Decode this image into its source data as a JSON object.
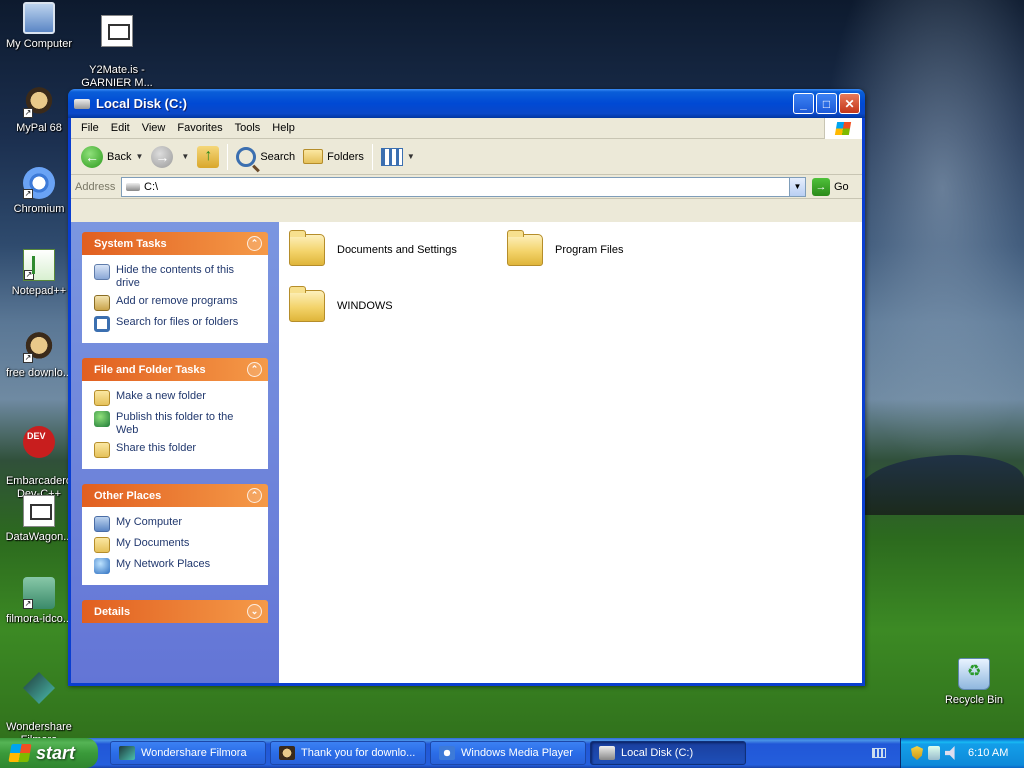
{
  "desktop": {
    "icons": [
      {
        "label": "My Computer"
      },
      {
        "label": "Y2Mate.is -\nGARNIER M..."
      },
      {
        "label": "MyPal 68"
      },
      {
        "label": "Chromium"
      },
      {
        "label": "Notepad++"
      },
      {
        "label": "free downlo..."
      },
      {
        "label": "Embarcadero\nDev-C++"
      },
      {
        "label": "DataWagon..."
      },
      {
        "label": "filmora-idco..."
      },
      {
        "label": "Wondershare\nFilmora"
      },
      {
        "label": "Recycle Bin"
      }
    ]
  },
  "window": {
    "title": "Local Disk (C:)",
    "controls": {
      "minimize": "_",
      "maximize": "□",
      "close": "✕"
    },
    "menu": [
      "File",
      "Edit",
      "View",
      "Favorites",
      "Tools",
      "Help"
    ],
    "toolbar": {
      "back": "Back",
      "search": "Search",
      "folders": "Folders"
    },
    "address": {
      "label": "Address",
      "value": "C:\\",
      "go": "Go"
    },
    "taskpane": {
      "system_tasks": {
        "title": "System Tasks",
        "items": [
          "Hide the contents of this drive",
          "Add or remove programs",
          "Search for files or folders"
        ]
      },
      "file_folder_tasks": {
        "title": "File and Folder Tasks",
        "items": [
          "Make a new folder",
          "Publish this folder to the Web",
          "Share this folder"
        ]
      },
      "other_places": {
        "title": "Other Places",
        "items": [
          "My Computer",
          "My Documents",
          "My Network Places"
        ]
      },
      "details": {
        "title": "Details"
      }
    },
    "files": [
      "Documents and Settings",
      "Program Files",
      "WINDOWS"
    ]
  },
  "taskbar": {
    "start": "start",
    "buttons": [
      "Wondershare Filmora",
      "Thank you for downlo...",
      "Windows Media Player",
      "Local Disk (C:)"
    ],
    "clock": "6:10 AM"
  }
}
